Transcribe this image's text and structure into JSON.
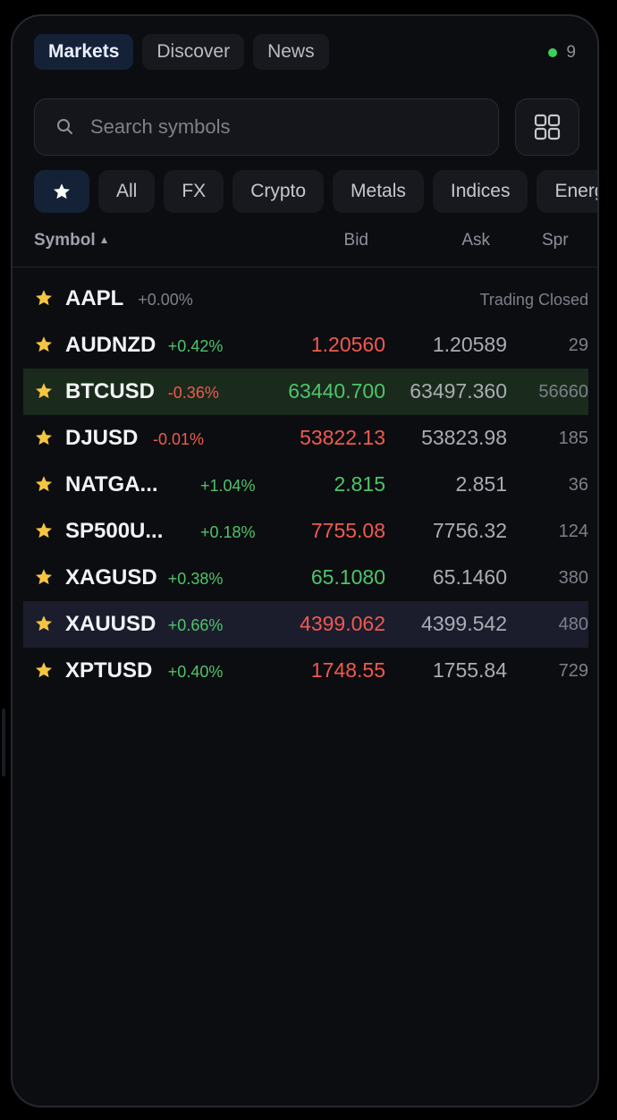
{
  "tabs": [
    {
      "label": "Markets",
      "active": true
    },
    {
      "label": "Discover",
      "active": false
    },
    {
      "label": "News",
      "active": false
    }
  ],
  "status": {
    "count": "9",
    "dot_color": "#3ccf5c"
  },
  "search": {
    "placeholder": "Search symbols",
    "value": ""
  },
  "filters": {
    "favorites_icon": "star-icon",
    "chips": [
      "All",
      "FX",
      "Crypto",
      "Metals",
      "Indices",
      "Energy"
    ]
  },
  "columns": {
    "symbol": "Symbol",
    "bid": "Bid",
    "ask": "Ask",
    "spread": "Spr"
  },
  "colors": {
    "up": "#4fc46a",
    "down": "#f05a4f",
    "star": "#f5c542",
    "accent": "#142137"
  },
  "rows": [
    {
      "symbol": "AAPL",
      "change": "+0.00%",
      "dir": "flat",
      "closed": true,
      "status": "Trading Closed"
    },
    {
      "symbol": "AUDNZD",
      "change": "+0.42%",
      "dir": "up",
      "bid": "1.20560",
      "bid_dir": "down",
      "ask": "1.20589",
      "spread": "29"
    },
    {
      "symbol": "BTCUSD",
      "change": "-0.36%",
      "dir": "down",
      "bid": "63440.700",
      "bid_dir": "up",
      "ask": "63497.360",
      "spread": "56660",
      "highlight": "green"
    },
    {
      "symbol": "DJUSD",
      "change": "-0.01%",
      "dir": "down",
      "bid": "53822.13",
      "bid_dir": "down",
      "ask": "53823.98",
      "spread": "185"
    },
    {
      "symbol": "NATGA...",
      "change": "+1.04%",
      "dir": "up",
      "bid": "2.815",
      "bid_dir": "up",
      "ask": "2.851",
      "spread": "36"
    },
    {
      "symbol": "SP500U...",
      "change": "+0.18%",
      "dir": "up",
      "bid": "7755.08",
      "bid_dir": "down",
      "ask": "7756.32",
      "spread": "124"
    },
    {
      "symbol": "XAGUSD",
      "change": "+0.38%",
      "dir": "up",
      "bid": "65.1080",
      "bid_dir": "up",
      "ask": "65.1460",
      "spread": "380"
    },
    {
      "symbol": "XAUUSD",
      "change": "+0.66%",
      "dir": "up",
      "bid": "4399.062",
      "bid_dir": "down",
      "ask": "4399.542",
      "spread": "480",
      "highlight": "blue"
    },
    {
      "symbol": "XPTUSD",
      "change": "+0.40%",
      "dir": "up",
      "bid": "1748.55",
      "bid_dir": "down",
      "ask": "1755.84",
      "spread": "729"
    }
  ]
}
